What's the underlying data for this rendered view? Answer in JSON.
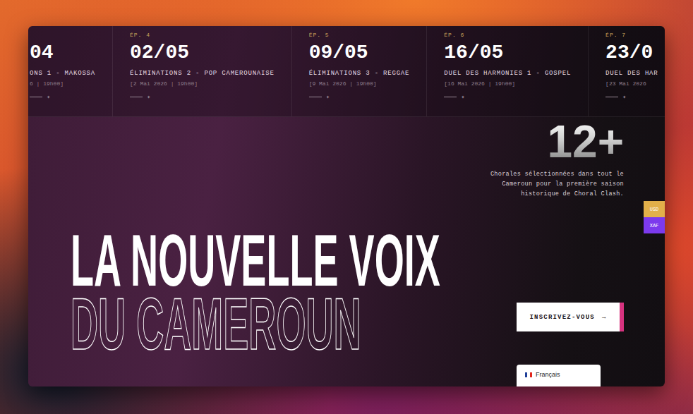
{
  "episodes": [
    {
      "label": "",
      "date": "04",
      "title": "ONS 1 - MAKOSSA",
      "schedule": "6 | 19h00]",
      "mark": "✦"
    },
    {
      "label": "ÉP. 4",
      "date": "02/05",
      "title": "ÉLIMINATIONS 2 - POP CAMEROUNAISE",
      "schedule": "[2 Mai 2026 | 19h00]",
      "mark": "✦"
    },
    {
      "label": "ÉP. 5",
      "date": "09/05",
      "title": "ÉLIMINATIONS 3 - REGGAE",
      "schedule": "[9 Mai 2026 | 19h00]",
      "mark": "✦"
    },
    {
      "label": "ÉP. 6",
      "date": "16/05",
      "title": "DUEL DES HARMONIES 1 - GOSPEL",
      "schedule": "[16 Mai 2026 | 19h00]",
      "mark": "✦"
    },
    {
      "label": "ÉP. 7",
      "date": "23/0",
      "title": "DUEL DES HAR",
      "schedule": "[23 Mai 2026",
      "mark": "✦"
    }
  ],
  "stats": {
    "value": "12+",
    "description": "Chorales sélectionnées dans tout le Cameroun pour la première saison historique de Choral Clash."
  },
  "currencies": [
    {
      "code": "USD",
      "color": "#e2b04a"
    },
    {
      "code": "XAF",
      "color": "#7c3aed"
    }
  ],
  "headline": {
    "line1": "LA NOUVELLE VOIX",
    "line2": "DU CAMEROUN"
  },
  "cta": {
    "label": "INSCRIVEZ-VOUS",
    "arrow": "→"
  },
  "language": {
    "label": "Français"
  }
}
